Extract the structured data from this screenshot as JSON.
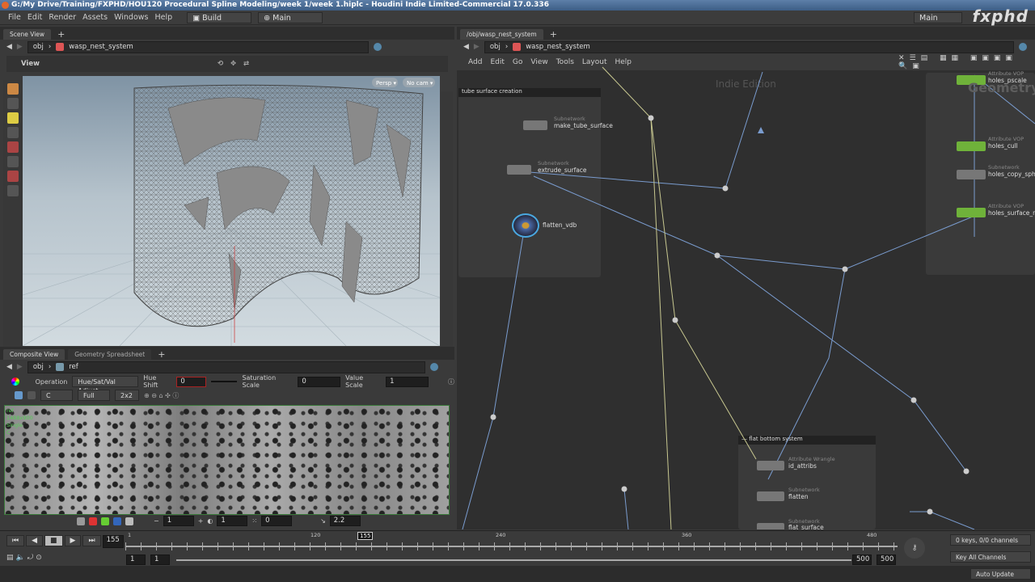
{
  "title": "G:/My Drive/Training/FXPHD/HOU120 Procedural Spline Modeling/week 1/week 1.hiplc - Houdini Indie Limited-Commercial 17.0.336",
  "menu": [
    "File",
    "Edit",
    "Render",
    "Assets",
    "Windows",
    "Help"
  ],
  "desktop": "Build",
  "workspace": "Main",
  "right_workspace": "Main",
  "brand": "fxphd",
  "scene": {
    "tabs": [
      "Scene View"
    ],
    "path": [
      "obj",
      "wasp_nest_system"
    ],
    "view_label": "View",
    "persp": "Persp ▾",
    "cam": "No cam ▾"
  },
  "composite": {
    "tabs": [
      "Composite View",
      "Geometry Spreadsheet"
    ],
    "path": [
      "obj",
      "ref"
    ],
    "operation_label": "Operation",
    "operation": "Hue/Sat/Val Adjust",
    "hue_label": "Hue Shift",
    "hue": "0",
    "sat_label": "Saturation Scale",
    "sat": "0",
    "val_label": "Value Scale",
    "val": "1",
    "channel": "C",
    "res": "Full",
    "tile": "2x2",
    "overlay": [
      "ref",
      "1488x900",
      "Single",
      "C"
    ],
    "bottom": {
      "zoom": "1",
      "brightness": "1",
      "offset": "0",
      "gamma": "2.2"
    }
  },
  "network": {
    "tab": "/obj/wasp_nest_system",
    "path": [
      "obj",
      "wasp_nest_system"
    ],
    "menu": [
      "Add",
      "Edit",
      "Go",
      "View",
      "Tools",
      "Layout",
      "Help"
    ],
    "watermark": "Indie Edition",
    "context": "Geometry",
    "boxes": [
      {
        "title": "tube surface creation"
      },
      {
        "title": "flat bottom system"
      }
    ],
    "nodes": [
      {
        "type": "Subnetwork",
        "name": "make_tube_surface"
      },
      {
        "type": "Subnetwork",
        "name": "extrude_surface"
      },
      {
        "type": "",
        "name": "flatten_vdb"
      },
      {
        "type": "Attribute VOP",
        "name": "holes_pscale"
      },
      {
        "type": "Attribute VOP",
        "name": "holes_cull"
      },
      {
        "type": "Subnetwork",
        "name": "holes_copy_sphe"
      },
      {
        "type": "Attribute VOP",
        "name": "holes_surface_nc"
      },
      {
        "type": "Attribute Wrangle",
        "name": "id_attribs"
      },
      {
        "type": "Subnetwork",
        "name": "flatten"
      },
      {
        "type": "Subnetwork",
        "name": "flat_surface"
      }
    ]
  },
  "timeline": {
    "frame": "155",
    "marker": "155",
    "ticks": [
      "1",
      "120",
      "240",
      "360",
      "480"
    ],
    "start": "1",
    "range_start": "1",
    "range_end": "500",
    "end": "500",
    "keys": "0 keys, 0/0 channels",
    "key_mode": "Key All Channels",
    "update": "Auto Update",
    "playhead_fraction": 0.309
  }
}
